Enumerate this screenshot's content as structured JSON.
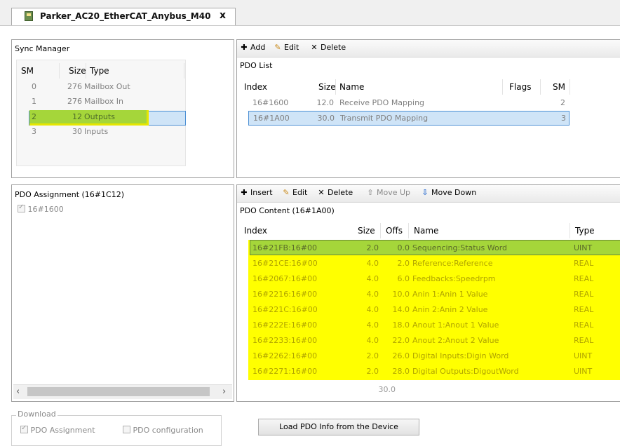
{
  "tab": {
    "title": "Parker_AC20_EtherCAT_Anybus_M40",
    "close": "x"
  },
  "sync_manager": {
    "title": "Sync Manager",
    "headers": {
      "sm": "SM",
      "size": "Size",
      "type": "Type"
    },
    "rows": [
      {
        "sm": "0",
        "size": "276",
        "type": "Mailbox Out"
      },
      {
        "sm": "1",
        "size": "276",
        "type": "Mailbox In"
      },
      {
        "sm": "2",
        "size": "12",
        "type": "Outputs"
      },
      {
        "sm": "3",
        "size": "30",
        "type": "Inputs"
      }
    ]
  },
  "pdo_list": {
    "toolbar": {
      "add": "Add",
      "edit": "Edit",
      "delete": "Delete"
    },
    "title": "PDO List",
    "headers": {
      "index": "Index",
      "size": "Size",
      "name": "Name",
      "flags": "Flags",
      "sm": "SM"
    },
    "rows": [
      {
        "index": "16#1600",
        "size": "12.0",
        "name": "Receive PDO Mapping",
        "flags": "",
        "sm": "2"
      },
      {
        "index": "16#1A00",
        "size": "30.0",
        "name": "Transmit PDO Mapping",
        "flags": "",
        "sm": "3"
      }
    ]
  },
  "pdo_assignment": {
    "title": "PDO Assignment (16#1C12)",
    "items": [
      {
        "label": "16#1600",
        "checked": true
      }
    ]
  },
  "pdo_content": {
    "toolbar": {
      "insert": "Insert",
      "edit": "Edit",
      "delete": "Delete",
      "move_up": "Move Up",
      "move_down": "Move Down"
    },
    "title": "PDO Content (16#1A00)",
    "headers": {
      "index": "Index",
      "size": "Size",
      "offs": "Offs",
      "name": "Name",
      "type": "Type"
    },
    "rows": [
      {
        "index": "16#21FB:16#00",
        "size": "2.0",
        "offs": "0.0",
        "name": "Sequencing:Status Word",
        "type": "UINT"
      },
      {
        "index": "16#21CE:16#00",
        "size": "4.0",
        "offs": "2.0",
        "name": "Reference:Reference",
        "type": "REAL"
      },
      {
        "index": "16#2067:16#00",
        "size": "4.0",
        "offs": "6.0",
        "name": "Feedbacks:Speedrpm",
        "type": "REAL"
      },
      {
        "index": "16#2216:16#00",
        "size": "4.0",
        "offs": "10.0",
        "name": "Anin 1:Anin 1 Value",
        "type": "REAL"
      },
      {
        "index": "16#221C:16#00",
        "size": "4.0",
        "offs": "14.0",
        "name": "Anin 2:Anin 2 Value",
        "type": "REAL"
      },
      {
        "index": "16#222E:16#00",
        "size": "4.0",
        "offs": "18.0",
        "name": "Anout 1:Anout 1 Value",
        "type": "REAL"
      },
      {
        "index": "16#2233:16#00",
        "size": "4.0",
        "offs": "22.0",
        "name": "Anout 2:Anout 2 Value",
        "type": "REAL"
      },
      {
        "index": "16#2262:16#00",
        "size": "2.0",
        "offs": "26.0",
        "name": "Digital Inputs:Digin Word",
        "type": "UINT"
      },
      {
        "index": "16#2271:16#00",
        "size": "2.0",
        "offs": "28.0",
        "name": "Digital Outputs:DigoutWord",
        "type": "UINT"
      }
    ],
    "total": "30.0"
  },
  "download": {
    "legend": "Download",
    "pdo_assignment": "PDO Assignment",
    "pdo_configuration": "PDO configuration"
  },
  "load_button": "Load PDO Info from the Device",
  "colors": {
    "highlight_yellow": "#ffff00",
    "highlight_green": "#a5d63a",
    "selection_blue": "#cfe4f7"
  },
  "icons": [
    "editor-tab-icon",
    "close-icon",
    "add-icon",
    "edit-icon",
    "delete-icon",
    "insert-icon",
    "move-up-icon",
    "move-down-icon",
    "scroll-left-icon",
    "scroll-right-icon"
  ]
}
